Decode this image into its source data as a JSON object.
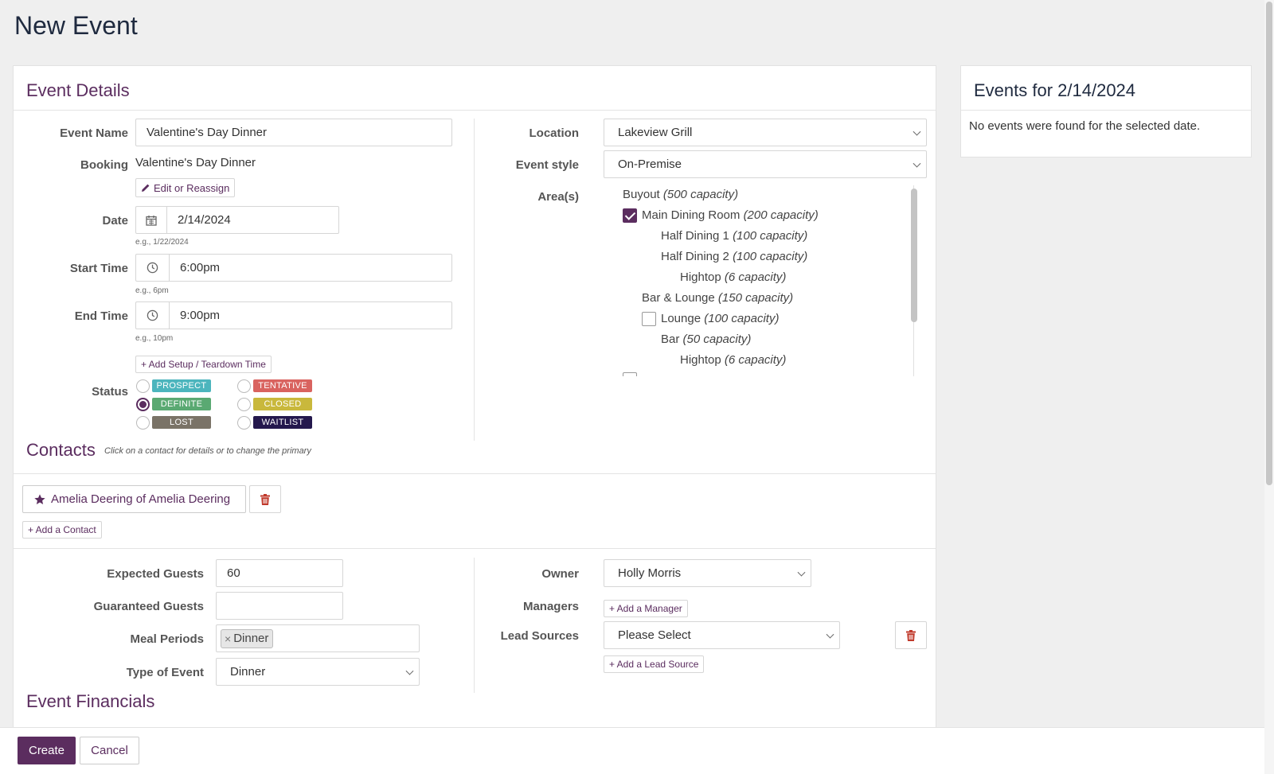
{
  "page": {
    "title": "New Event"
  },
  "event_details": {
    "heading": "Event Details",
    "event_name": {
      "label": "Event Name",
      "value": "Valentine's Day Dinner"
    },
    "booking": {
      "label": "Booking",
      "value": "Valentine's Day Dinner",
      "edit_button": "Edit or Reassign"
    },
    "date": {
      "label": "Date",
      "value": "2/14/2024",
      "hint": "e.g., 1/22/2024"
    },
    "start_time": {
      "label": "Start Time",
      "value": "6:00pm",
      "hint": "e.g., 6pm"
    },
    "end_time": {
      "label": "End Time",
      "value": "9:00pm",
      "hint": "e.g., 10pm"
    },
    "setup_button": "+ Add Setup / Teardown Time",
    "status": {
      "label": "Status",
      "options": [
        {
          "label": "PROSPECT",
          "color": "#4cb5bd",
          "selected": false
        },
        {
          "label": "TENTATIVE",
          "color": "#d9635f",
          "selected": false
        },
        {
          "label": "DEFINITE",
          "color": "#5aa972",
          "selected": true
        },
        {
          "label": "CLOSED",
          "color": "#c9b83c",
          "selected": false
        },
        {
          "label": "LOST",
          "color": "#7a7367",
          "selected": false
        },
        {
          "label": "WAITLIST",
          "color": "#24184d",
          "selected": false
        }
      ]
    },
    "location": {
      "label": "Location",
      "value": "Lakeview Grill"
    },
    "event_style": {
      "label": "Event style",
      "value": "On-Premise"
    },
    "areas": {
      "label": "Area(s)",
      "items": [
        {
          "name": "Buyout",
          "capacity": "(500 capacity)",
          "checkbox": false,
          "checked": false
        },
        {
          "name": "Main Dining Room",
          "capacity": "(200 capacity)",
          "checkbox": true,
          "checked": true
        },
        {
          "name": "Half Dining 1",
          "capacity": "(100 capacity)",
          "checkbox": false,
          "checked": false
        },
        {
          "name": "Half Dining 2",
          "capacity": "(100 capacity)",
          "checkbox": false,
          "checked": false
        },
        {
          "name": "Hightop",
          "capacity": "(6 capacity)",
          "checkbox": false,
          "checked": false
        },
        {
          "name": "Bar & Lounge",
          "capacity": "(150 capacity)",
          "checkbox": false,
          "checked": false
        },
        {
          "name": "Lounge",
          "capacity": "(100 capacity)",
          "checkbox": true,
          "checked": false
        },
        {
          "name": "Bar",
          "capacity": "(50 capacity)",
          "checkbox": false,
          "checked": false
        },
        {
          "name": "Hightop",
          "capacity": "(6 capacity)",
          "checkbox": false,
          "checked": false
        }
      ]
    }
  },
  "contacts": {
    "heading": "Contacts",
    "hint": "Click on a contact for details or to change the primary",
    "primary_contact": "Amelia Deering of Amelia Deering",
    "add_button": "+ Add a Contact"
  },
  "details2": {
    "expected_guests": {
      "label": "Expected Guests",
      "value": "60"
    },
    "guaranteed_guests": {
      "label": "Guaranteed Guests",
      "value": ""
    },
    "meal_periods": {
      "label": "Meal Periods",
      "tag": "Dinner",
      "tag_remove": "×"
    },
    "type_of_event": {
      "label": "Type of Event",
      "value": "Dinner"
    },
    "owner": {
      "label": "Owner",
      "value": "Holly Morris"
    },
    "managers": {
      "label": "Managers",
      "add_button": "+ Add a Manager"
    },
    "lead_sources": {
      "label": "Lead Sources",
      "value": "Please Select",
      "add_button": "+ Add a Lead Source"
    }
  },
  "financials": {
    "heading": "Event Financials"
  },
  "side_panel": {
    "heading": "Events for 2/14/2024",
    "empty_text": "No events were found for the selected date."
  },
  "footer": {
    "create": "Create",
    "cancel": "Cancel"
  },
  "colors": {
    "accent": "#5b2d5f",
    "danger": "#c0392b"
  }
}
